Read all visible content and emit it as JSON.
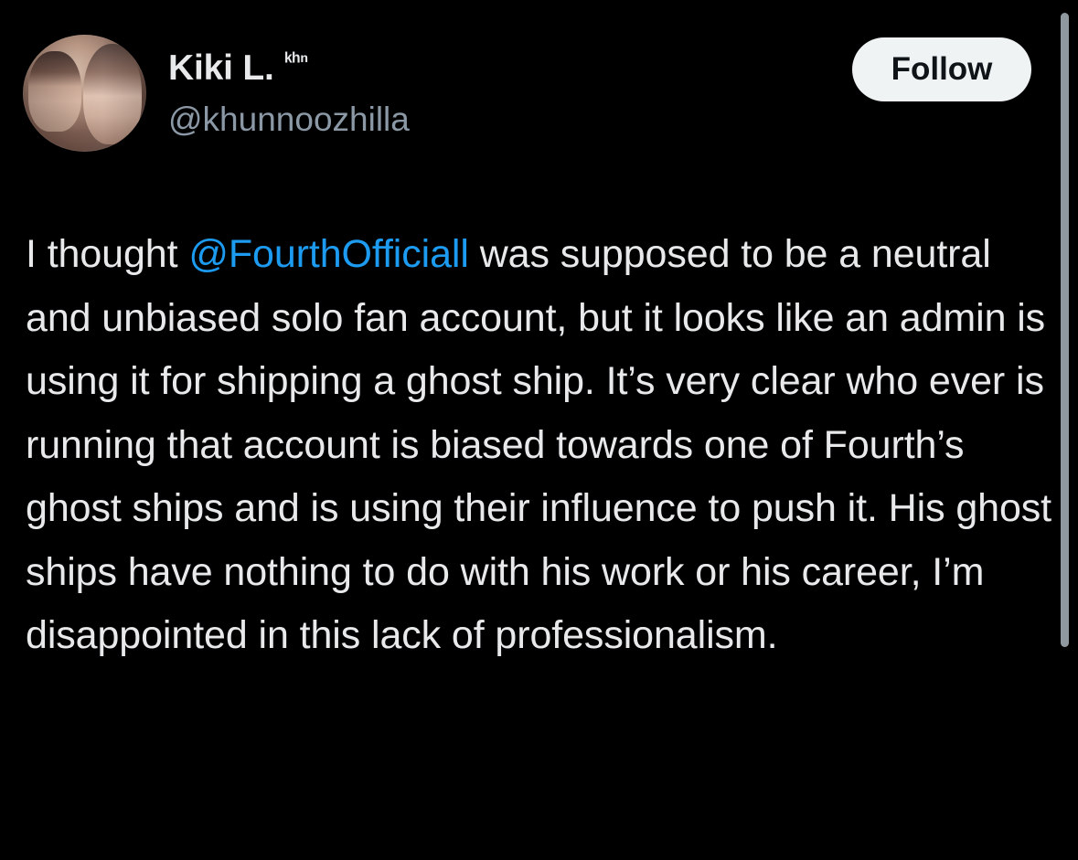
{
  "tweet": {
    "author": {
      "display_name": "Kiki L.",
      "name_suffix": "ᵏʰⁿ",
      "handle": "@khunnoozhilla"
    },
    "follow_label": "Follow",
    "text": {
      "part1": "I thought ",
      "mention": "@FourthOfficiall",
      "part2": " was supposed to be a neutral and unbiased solo fan account, but it looks like an admin is using it for shipping a ghost ship. It’s very clear who ever is running that account is biased towards one of Fourth’s ghost ships and is using their influence to push it.  His ghost ships have nothing to do with his work or his career, I’m disappointed in this lack of professionalism."
    }
  },
  "colors": {
    "background": "#000000",
    "primary_text": "#e7e9ea",
    "secondary_text": "#8b98a5",
    "mention_blue": "#1d9bf0",
    "follow_button_bg": "#eff3f4",
    "follow_button_text": "#0f1419"
  },
  "icons": {
    "avatar": "profile-photo"
  }
}
